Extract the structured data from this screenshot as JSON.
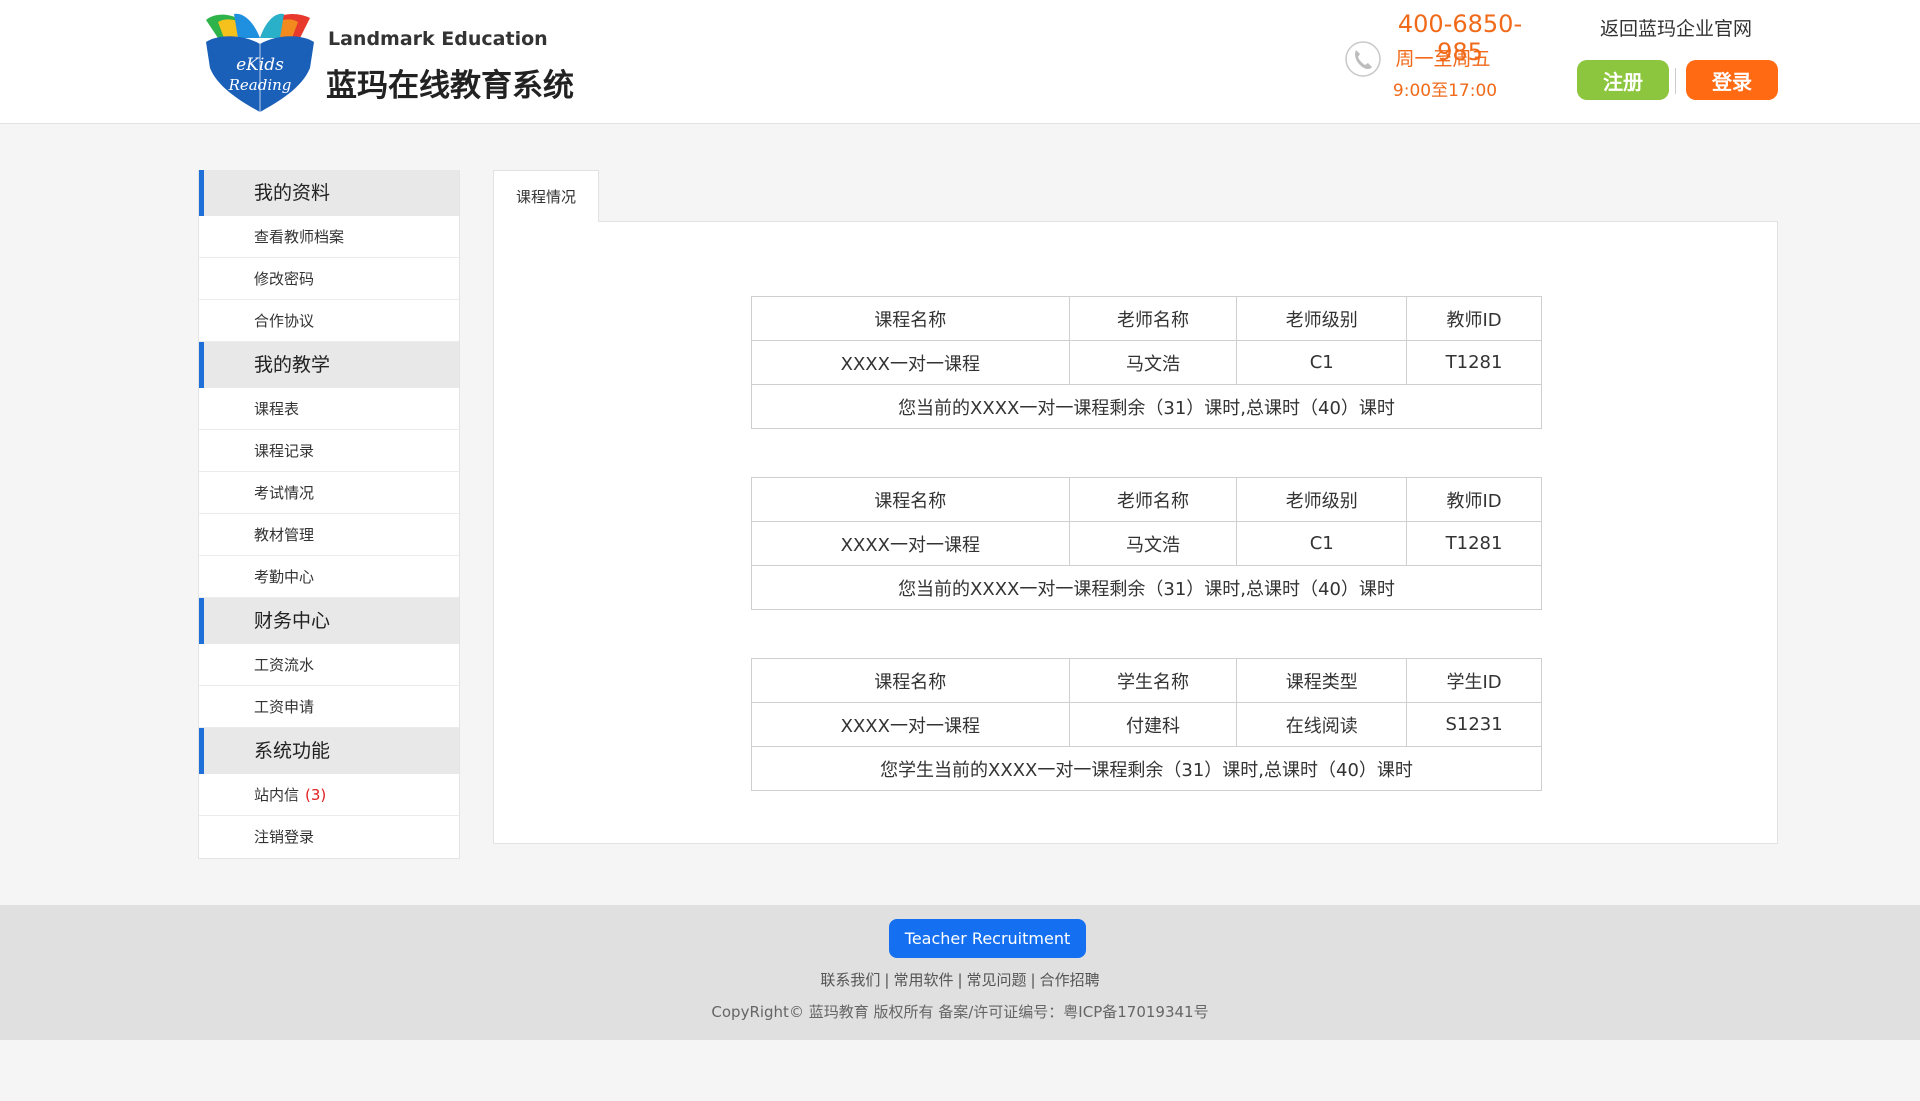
{
  "header": {
    "logo_text_top": "eKids",
    "logo_text_bottom": "Reading",
    "brand_en": "Landmark Education",
    "brand_cn": "蓝玛在线教育系统",
    "phone_number": "400-6850-985",
    "phone_days": "周一至周五",
    "phone_hours": "9:00至17:00",
    "corp_link": "返回蓝玛企业官网",
    "register_label": "注册",
    "login_label": "登录"
  },
  "sidebar": {
    "sections": [
      {
        "title": "我的资料",
        "items": [
          {
            "label": "查看教师档案"
          },
          {
            "label": "修改密码"
          },
          {
            "label": "合作协议"
          }
        ]
      },
      {
        "title": "我的教学",
        "items": [
          {
            "label": "课程表"
          },
          {
            "label": "课程记录"
          },
          {
            "label": "考试情况"
          },
          {
            "label": "教材管理"
          },
          {
            "label": "考勤中心"
          }
        ]
      },
      {
        "title": "财务中心",
        "items": [
          {
            "label": "工资流水"
          },
          {
            "label": "工资申请"
          }
        ]
      },
      {
        "title": "系统功能",
        "items": [
          {
            "label": "站内信",
            "badge": "(3)"
          },
          {
            "label": "注销登录"
          }
        ]
      }
    ]
  },
  "main": {
    "tab_label": "课程情况",
    "tables": [
      {
        "headers": [
          "课程名称",
          "老师名称",
          "老师级别",
          "教师ID"
        ],
        "row": [
          "XXXX一对一课程",
          "马文浩",
          "C1",
          "T1281"
        ],
        "summary": "您当前的XXXX一对一课程剩余（31）课时,总课时（40）课时"
      },
      {
        "headers": [
          "课程名称",
          "老师名称",
          "老师级别",
          "教师ID"
        ],
        "row": [
          "XXXX一对一课程",
          "马文浩",
          "C1",
          "T1281"
        ],
        "summary": "您当前的XXXX一对一课程剩余（31）课时,总课时（40）课时"
      },
      {
        "headers": [
          "课程名称",
          "学生名称",
          "课程类型",
          "学生ID"
        ],
        "row": [
          "XXXX一对一课程",
          "付建科",
          "在线阅读",
          "S1231"
        ],
        "summary": "您学生当前的XXXX一对一课程剩余（31）课时,总课时（40）课时"
      }
    ]
  },
  "footer": {
    "recruit_label": "Teacher Recruitment",
    "links": [
      "联系我们",
      "常用软件",
      "常见问题",
      "合作招聘"
    ],
    "copyright": "CopyRight© 蓝玛教育 版权所有 备案/许可证编号：粤ICP备17019341号"
  },
  "colors": {
    "accent_blue": "#1f6fd8",
    "phone_orange": "#f06a1a",
    "register_green": "#8cc63e",
    "login_orange": "#ff6a13",
    "recruit_blue": "#1470f0",
    "badge_red": "#e02020"
  },
  "icons": [
    "book-logo-icon",
    "phone-icon"
  ]
}
